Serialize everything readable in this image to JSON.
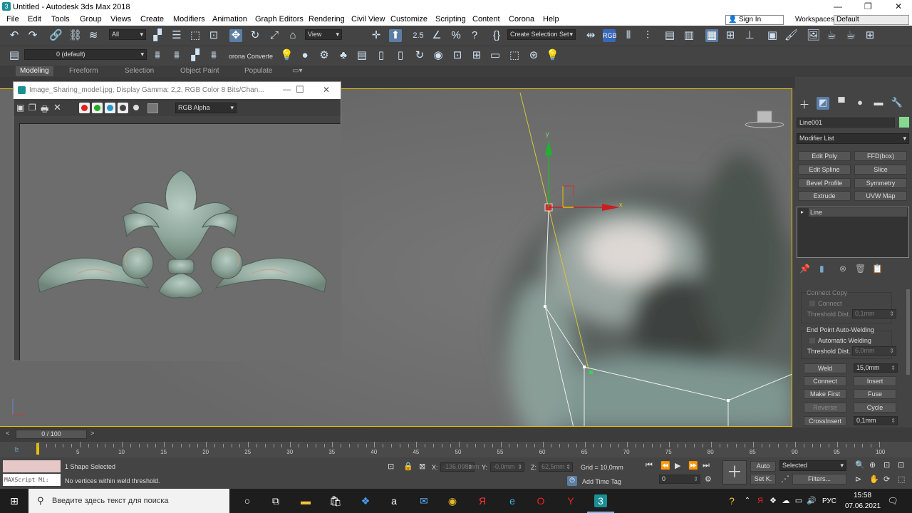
{
  "window": {
    "title": "Untitled - Autodesk 3ds Max 2018"
  },
  "menu": [
    "File",
    "Edit",
    "Tools",
    "Group",
    "Views",
    "Create",
    "Modifiers",
    "Animation",
    "Graph Editors",
    "Rendering",
    "Civil View",
    "Customize",
    "Scripting",
    "Content",
    "Corona",
    "Help"
  ],
  "account": {
    "sign_in": "Sign In",
    "workspaces_label": "Workspaces:",
    "workspace": "Default"
  },
  "toolbar": {
    "selection_filter": "All",
    "ref_coord": "View",
    "named_sel": "Create Selection Set",
    "snap_label": "2.5",
    "layer": "0 (default)",
    "corona_label": "orona Converte",
    "rgb_label": "RGB"
  },
  "ribbon": {
    "tabs": [
      "Modeling",
      "Freeform",
      "Selection",
      "Object Paint",
      "Populate"
    ]
  },
  "image_window": {
    "title": "Image_Sharing_model.jpg, Display Gamma: 2,2, RGB Color 8 Bits/Chan...",
    "channel": "RGB Alpha"
  },
  "viewport": {
    "axis_y": "y",
    "axis_x": "x"
  },
  "command_panel": {
    "object_name": "Line001",
    "object_color": "#86d890",
    "modifier_list": "Modifier List",
    "modifiers": [
      "Edit Poly",
      "FFD(box)",
      "Edit Spline",
      "Slice",
      "Bevel Profile",
      "Symmetry",
      "Extrude",
      "UVW Map"
    ],
    "stack_item": "Line",
    "connect_copy": "Connect Copy",
    "connect": "Connect",
    "threshold_label": "Threshold Dist.",
    "threshold_val": "0,1mm",
    "end_point_welding": "End Point Auto-Welding",
    "automatic_welding": "Automatic Welding",
    "threshold2_val": "6,0mm",
    "weld": "Weld",
    "weld_val": "15,0mm",
    "connect_btn": "Connect",
    "insert": "Insert",
    "make_first": "Make First",
    "fuse": "Fuse",
    "reverse": "Reverse",
    "cycle": "Cycle",
    "cross_insert": "CrossInsert",
    "cross_val": "0,1mm"
  },
  "timeline": {
    "frame": "0 / 100",
    "ticks": [
      "0",
      "5",
      "10",
      "15",
      "20",
      "25",
      "30",
      "35",
      "40",
      "45",
      "50",
      "55",
      "60",
      "65",
      "70",
      "75",
      "80",
      "85",
      "90",
      "95",
      "100"
    ]
  },
  "status": {
    "maxscript": "MAXScript Mi:",
    "selected": "1 Shape Selected",
    "prompt": "No vertices within weld threshold.",
    "x_label": "X:",
    "x_val": "-136,098mm",
    "y_label": "Y:",
    "y_val": "-0,0mm",
    "z_label": "Z:",
    "z_val": "62,5mm",
    "grid": "Grid = 10,0mm",
    "add_time_tag": "Add Time Tag",
    "auto": "Auto",
    "set_k": "Set K.",
    "sel_set": "Selected",
    "filters": "Filters...",
    "frame_field": "0"
  },
  "taskbar": {
    "search": "Введите здесь текст для поиска",
    "lang": "РУС",
    "time": "15:58",
    "date": "07.06.2021"
  }
}
